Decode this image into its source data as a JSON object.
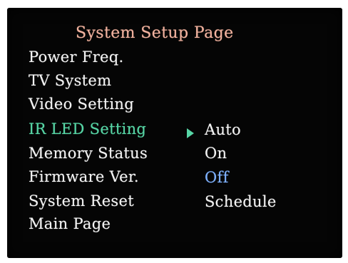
{
  "page": {
    "title": "System Setup Page"
  },
  "menu": {
    "items": [
      {
        "label": "Power Freq."
      },
      {
        "label": "TV System"
      },
      {
        "label": "Video Setting"
      },
      {
        "label": "IR LED Setting"
      },
      {
        "label": "Memory Status"
      },
      {
        "label": "Firmware Ver."
      },
      {
        "label": "System Reset"
      },
      {
        "label": "Main Page"
      }
    ],
    "selected_index": 3,
    "arrow_icon": "right-triangle-icon"
  },
  "submenu": {
    "options": [
      {
        "label": "Auto"
      },
      {
        "label": "On"
      },
      {
        "label": "Off"
      },
      {
        "label": "Schedule"
      }
    ],
    "highlighted_index": 2
  },
  "colors": {
    "background": "#050505",
    "title": "#f2b3a0",
    "text": "#f4f4f4",
    "selected": "#57d6a6",
    "highlight": "#7fb2ff"
  }
}
